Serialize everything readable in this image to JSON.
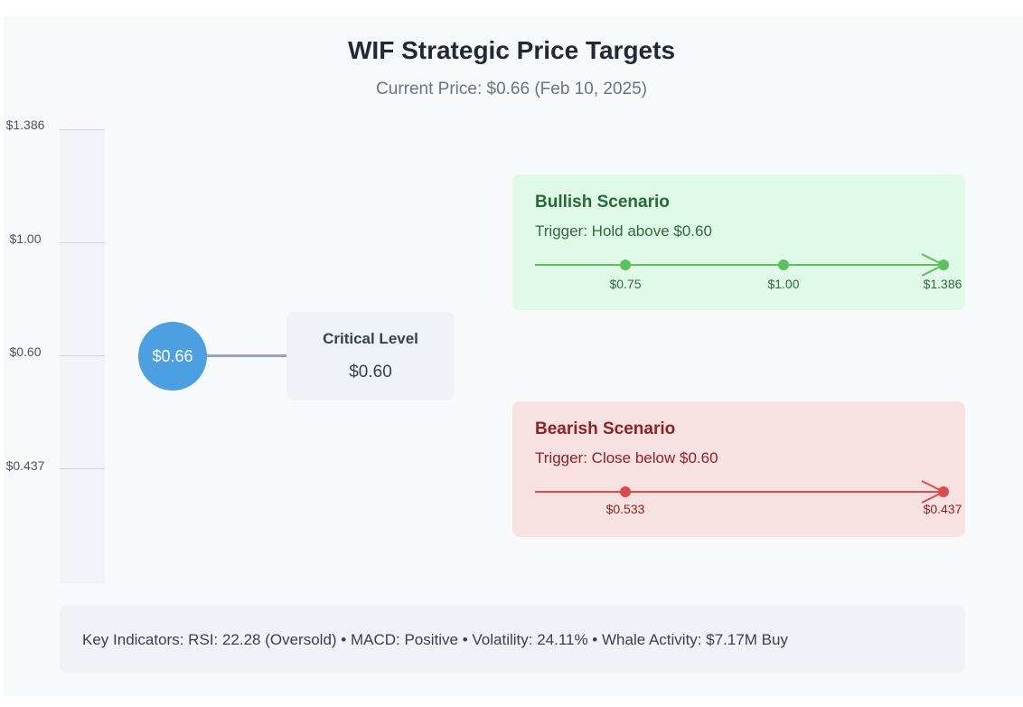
{
  "header": {
    "title": "WIF Strategic Price Targets",
    "subtitle": "Current Price: $0.66 (Feb 10, 2025)"
  },
  "scale": {
    "ticks": [
      {
        "value": 1.386,
        "label": "$1.386"
      },
      {
        "value": 1.0,
        "label": "$1.00"
      },
      {
        "value": 0.6,
        "label": "$0.60"
      },
      {
        "value": 0.437,
        "label": "$0.437"
      }
    ]
  },
  "current": {
    "label": "$0.66"
  },
  "critical": {
    "title": "Critical Level",
    "value": "$0.60"
  },
  "bullish": {
    "title": "Bullish Scenario",
    "trigger": "Trigger: Hold above $0.60",
    "color": "#5cc05c",
    "targets": [
      "$0.75",
      "$1.00",
      "$1.386"
    ]
  },
  "bearish": {
    "title": "Bearish Scenario",
    "trigger": "Trigger: Close below $0.60",
    "color": "#dd4a4a",
    "targets": [
      "$0.533",
      "$0.437"
    ]
  },
  "indicators": {
    "text": "Key Indicators: RSI: 22.28 (Oversold) • MACD: Positive • Volatility: 24.11% • Whale Activity: $7.17M Buy"
  }
}
